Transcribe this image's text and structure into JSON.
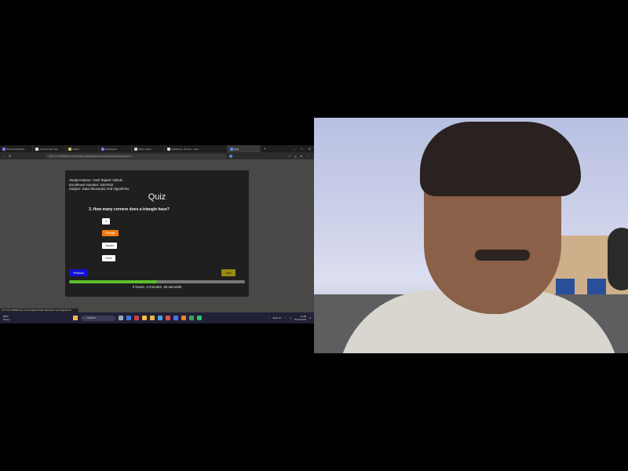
{
  "browser": {
    "tabs": [
      {
        "label": "Personal Website"
      },
      {
        "label": "Artistic Proof Cam"
      },
      {
        "label": "Github"
      },
      {
        "label": "Dashboard"
      },
      {
        "label": "Frame Tools"
      },
      {
        "label": "Stabilizing - Proctor - Hunt"
      },
      {
        "label": "Quiz"
      }
    ],
    "url": "127.0.0.1:5500/index.html?subject=Data%20Structures%20and%20Algorithms"
  },
  "quiz": {
    "student_name": "Student Name: Yash Rajesh Vahule",
    "enrollment": "Enrollment Number: 2207032",
    "subject": "Subject: Data Structures And Algorithms",
    "title": "Quiz",
    "question": "3. How many corners does a triangle have?",
    "options": [
      {
        "label": "3",
        "selected": false
      },
      {
        "label": "Triangle",
        "selected": true
      },
      {
        "label": "Square",
        "selected": false
      },
      {
        "label": "Circle",
        "selected": false
      }
    ],
    "prev_label": "Previous",
    "next_label": "Next",
    "progress": 0.5,
    "timer": "0 hours, 3 minutes, 45 seconds"
  },
  "statusbar": {
    "text": "127.0.0.1:5500/index.html?subject=Data Structures and Algorithms"
  },
  "taskbar": {
    "weather_temp": "34°C",
    "weather_desc": "Sunny",
    "search_placeholder": "Search",
    "time": "14:05",
    "date": "23-04-2024",
    "lang": "ENG IN"
  },
  "colors": {
    "selected_option": "#f07a10",
    "prev_button": "#1010d8",
    "next_button": "#9a8a10",
    "progress_fill": "#5cc12a"
  }
}
